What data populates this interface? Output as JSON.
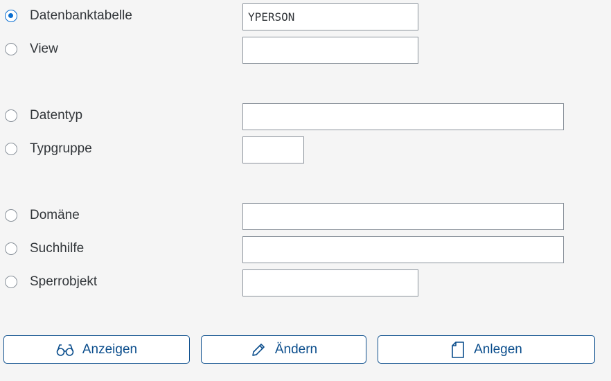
{
  "form": {
    "options": [
      {
        "label": "Datenbanktabelle",
        "checked": true,
        "value": "YPERSON"
      },
      {
        "label": "View",
        "checked": false,
        "value": ""
      },
      {
        "label": "Datentyp",
        "checked": false,
        "value": ""
      },
      {
        "label": "Typgruppe",
        "checked": false,
        "value": ""
      },
      {
        "label": "Domäne",
        "checked": false,
        "value": ""
      },
      {
        "label": "Suchhilfe",
        "checked": false,
        "value": ""
      },
      {
        "label": "Sperrobjekt",
        "checked": false,
        "value": ""
      }
    ]
  },
  "buttons": {
    "display": {
      "label": "Anzeigen",
      "icon": "glasses-icon"
    },
    "change": {
      "label": "Ändern",
      "icon": "pencil-icon"
    },
    "create": {
      "label": "Anlegen",
      "icon": "document-icon"
    }
  },
  "colors": {
    "accent": "#0a6ed1",
    "button_text": "#0a4d8c",
    "background": "#f5f5f5"
  }
}
